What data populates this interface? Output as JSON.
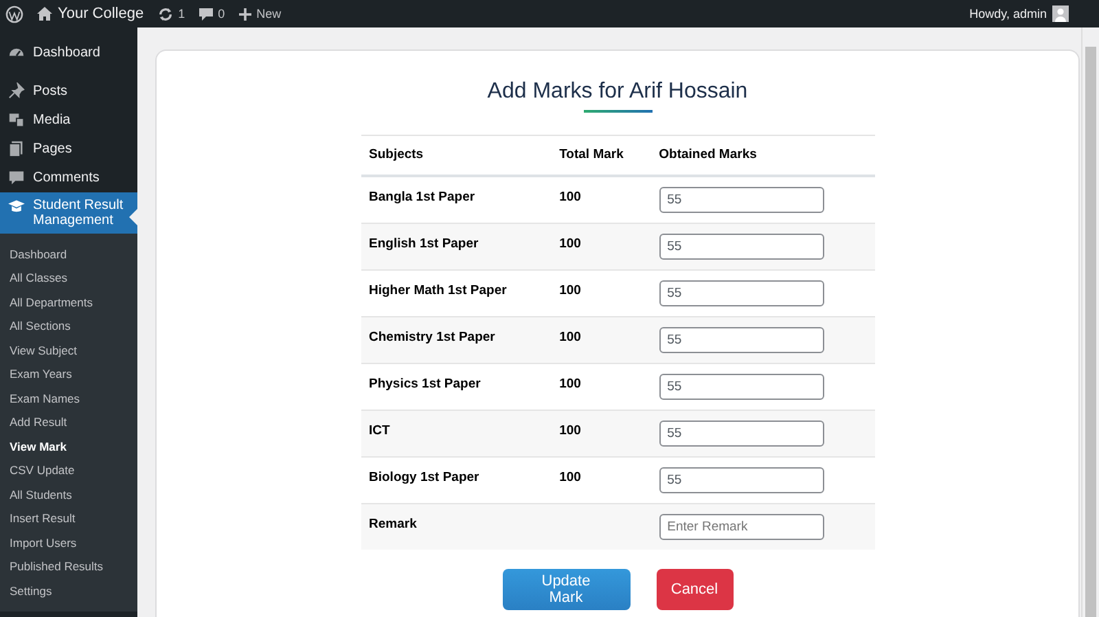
{
  "admin_bar": {
    "site_name": "Your College",
    "updates": "1",
    "comments": "0",
    "new_label": "New",
    "greeting": "Howdy, admin"
  },
  "sidebar": {
    "menu": [
      {
        "label": "Dashboard",
        "selected": false
      },
      {
        "label": "Posts",
        "selected": false
      },
      {
        "label": "Media",
        "selected": false
      },
      {
        "label": "Pages",
        "selected": false
      },
      {
        "label": "Comments",
        "selected": false
      },
      {
        "label": "Student Result Management",
        "selected": true
      }
    ],
    "submenu": [
      {
        "label": "Dashboard",
        "selected": false
      },
      {
        "label": "All Classes",
        "selected": false
      },
      {
        "label": "All Departments",
        "selected": false
      },
      {
        "label": "All Sections",
        "selected": false
      },
      {
        "label": "View Subject",
        "selected": false
      },
      {
        "label": "Exam Years",
        "selected": false
      },
      {
        "label": "Exam Names",
        "selected": false
      },
      {
        "label": "Add Result",
        "selected": false
      },
      {
        "label": "View Mark",
        "selected": true
      },
      {
        "label": "CSV Update",
        "selected": false
      },
      {
        "label": "All Students",
        "selected": false
      },
      {
        "label": "Insert Result",
        "selected": false
      },
      {
        "label": "Import Users",
        "selected": false
      },
      {
        "label": "Published Results",
        "selected": false
      },
      {
        "label": "Settings",
        "selected": false
      }
    ]
  },
  "form": {
    "title": "Add Marks for Arif Hossain",
    "table": {
      "columns": [
        "Subjects",
        "Total Mark",
        "Obtained Marks"
      ],
      "rows": [
        {
          "kind": "mark",
          "subject": "Bangla 1st Paper",
          "total": "100",
          "value": "55"
        },
        {
          "kind": "mark",
          "subject": "English 1st Paper",
          "total": "100",
          "value": "55"
        },
        {
          "kind": "mark",
          "subject": "Higher Math 1st Paper",
          "total": "100",
          "value": "55"
        },
        {
          "kind": "mark",
          "subject": "Chemistry 1st Paper",
          "total": "100",
          "value": "55"
        },
        {
          "kind": "mark",
          "subject": "Physics 1st Paper",
          "total": "100",
          "value": "55"
        },
        {
          "kind": "mark",
          "subject": "ICT",
          "total": "100",
          "value": "55"
        },
        {
          "kind": "mark",
          "subject": "Biology 1st Paper",
          "total": "100",
          "value": "55"
        },
        {
          "kind": "remark",
          "subject": "Remark",
          "placeholder": "Enter Remark"
        }
      ]
    },
    "buttons": [
      {
        "kind": "primary",
        "label": "Update Mark"
      },
      {
        "kind": "danger",
        "label": "Cancel"
      }
    ]
  }
}
